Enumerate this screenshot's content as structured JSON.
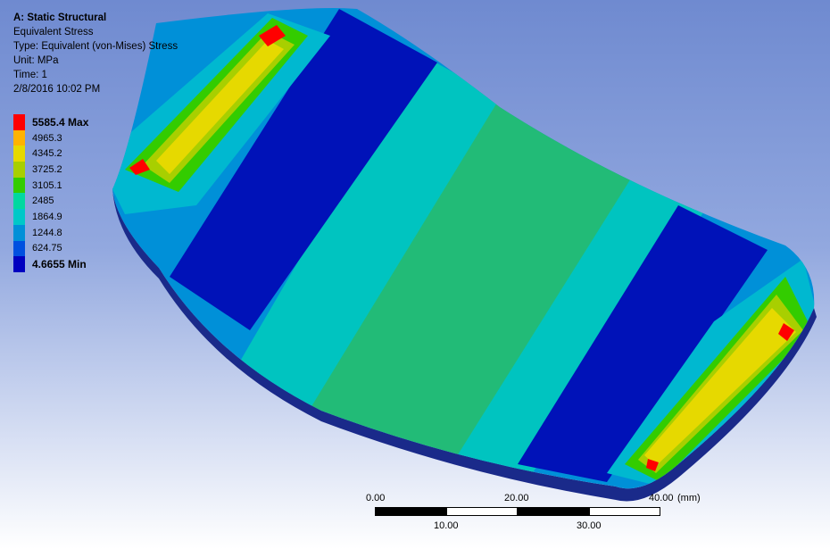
{
  "header": {
    "title": "A: Static Structural",
    "result": "Equivalent Stress",
    "type": "Type: Equivalent (von-Mises) Stress",
    "unit": "Unit: MPa",
    "time": "Time: 1",
    "date": "2/8/2016 10:02 PM"
  },
  "legend": {
    "labels": [
      "5585.4 Max",
      "4965.3",
      "4345.2",
      "3725.2",
      "3105.1",
      "2485",
      "1864.9",
      "1244.8",
      "624.75",
      "4.6655 Min"
    ],
    "colors": [
      "#ff0000",
      "#ffb300",
      "#e6d900",
      "#a8cf00",
      "#33cc00",
      "#00d8a0",
      "#00c8c8",
      "#0090d8",
      "#0050e0",
      "#0000c0"
    ]
  },
  "scale": {
    "top_labels": [
      "0.00",
      "20.00",
      "40.00"
    ],
    "bottom_labels": [
      "10.00",
      "30.00"
    ],
    "unit": "(mm)"
  }
}
